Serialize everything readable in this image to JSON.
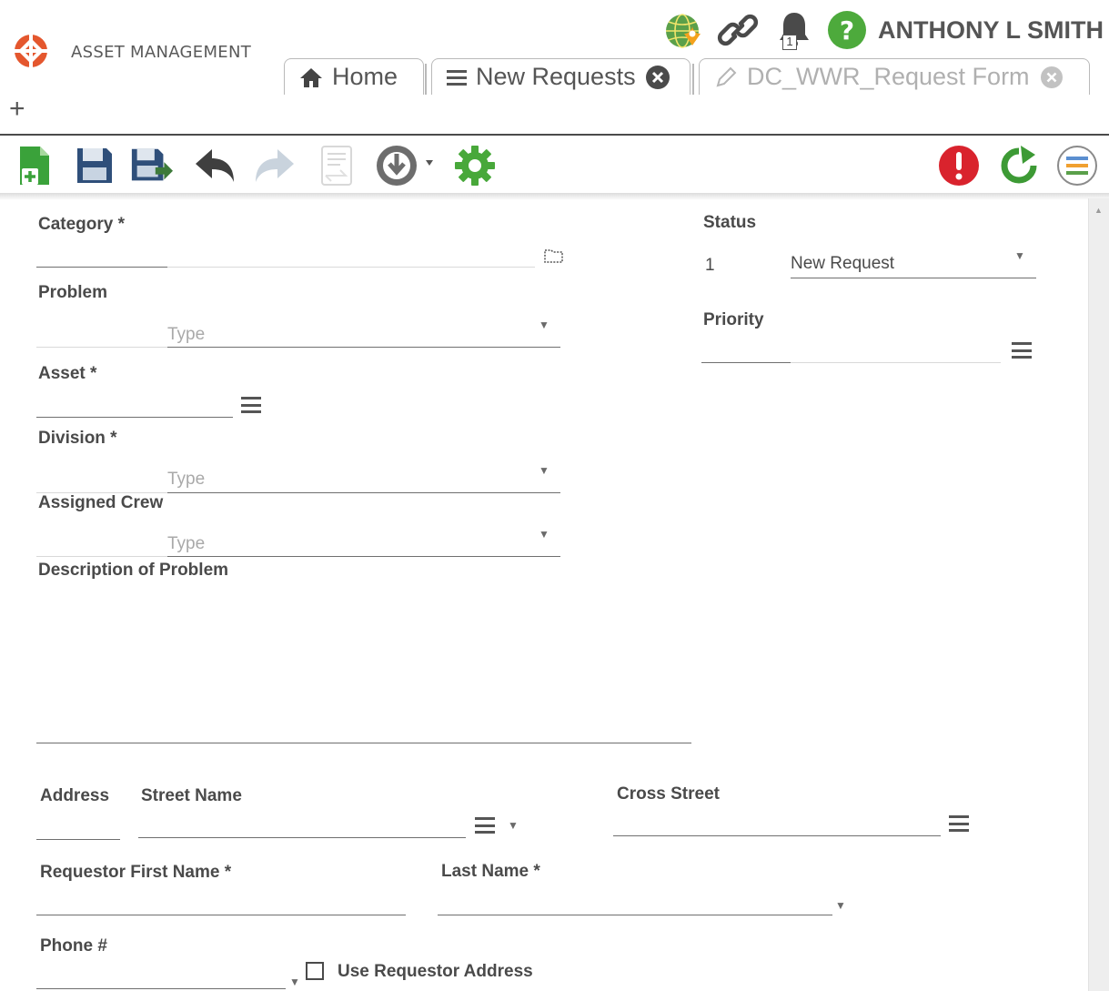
{
  "header": {
    "app_name": "ASSET MANAGEMENT",
    "user_name": "ANTHONY L SMITH",
    "notification_count": "1",
    "icons": [
      "globe-location-icon",
      "link-icon",
      "bell-icon",
      "help-icon"
    ]
  },
  "tabs": [
    {
      "label": "Home",
      "icon": "home-icon",
      "active": true
    },
    {
      "label": "New Requests",
      "icon": "list-icon",
      "closable": true,
      "active": true
    },
    {
      "label": "DC_WWR_Request Form",
      "icon": "pencil-icon",
      "closable": true,
      "active": false
    }
  ],
  "add_tab": "+",
  "toolbar": {
    "left": [
      "new-record-icon",
      "save-icon",
      "save-and-close-icon",
      "undo-icon",
      "redo-icon",
      "print-preview-icon",
      "actions-dropdown-icon",
      "settings-icon"
    ],
    "right": [
      "alert-icon",
      "refresh-icon",
      "list-view-icon"
    ]
  },
  "form": {
    "category": {
      "label": "Category *",
      "value": ""
    },
    "problem": {
      "label": "Problem",
      "placeholder": "Type"
    },
    "asset": {
      "label": "Asset *",
      "value": ""
    },
    "division": {
      "label": "Division *",
      "placeholder": "Type"
    },
    "assigned_crew": {
      "label": "Assigned Crew",
      "placeholder": "Type"
    },
    "description": {
      "label": "Description of Problem",
      "value": ""
    },
    "status": {
      "label": "Status",
      "code": "1",
      "value": "New Request"
    },
    "priority": {
      "label": "Priority",
      "value": ""
    },
    "address": {
      "label": "Address",
      "value": ""
    },
    "street_name": {
      "label": "Street Name",
      "value": ""
    },
    "cross_street": {
      "label": "Cross Street",
      "value": ""
    },
    "first_name": {
      "label": "Requestor First Name *",
      "value": ""
    },
    "last_name": {
      "label": "Last Name *",
      "value": ""
    },
    "phone": {
      "label": "Phone #",
      "value": ""
    },
    "use_requestor_address": {
      "label": "Use Requestor Address",
      "checked": false
    }
  },
  "colors": {
    "logo": "#e4572e",
    "new_icon_green": "#3aa23a",
    "save_blue": "#2f4f7a",
    "undo_gray": "#3f3f3f",
    "settings_green": "#48a83a",
    "alert_red": "#d9232d",
    "refresh_green": "#3d9a35",
    "help_green": "#4daa3c",
    "globe_green": "#5aa04a",
    "globe_pin_orange": "#f4a21c"
  }
}
